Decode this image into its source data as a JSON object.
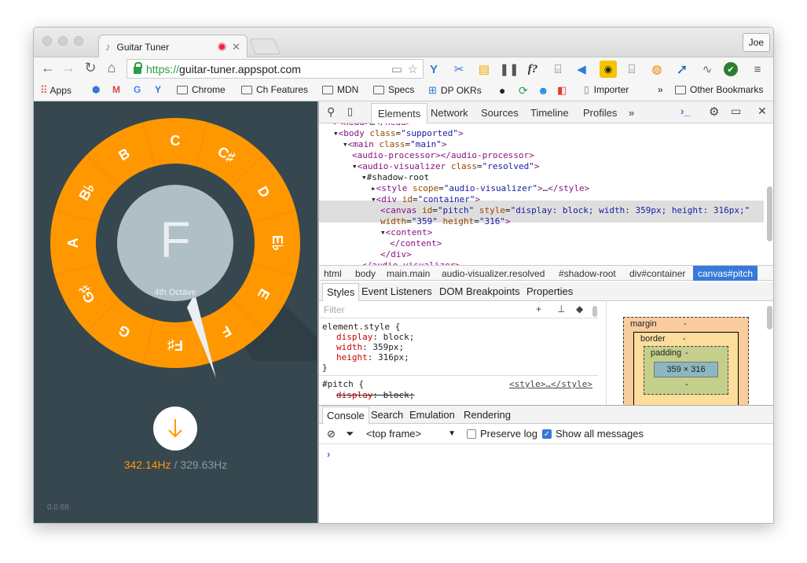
{
  "window": {
    "tab_title": "Guitar Tuner",
    "tab_favicon": "♪",
    "user_button": "Joe"
  },
  "toolbar": {
    "url_scheme": "https://",
    "url_host": "guitar-tuner.appspot.com"
  },
  "bookmarks": {
    "apps": "Apps",
    "items": [
      "Chrome",
      "Ch Features",
      "MDN",
      "Specs",
      "DP OKRs",
      "Importer"
    ],
    "overflow": "»",
    "other": "Other Bookmarks"
  },
  "tuner": {
    "notes": [
      "C",
      "C♯",
      "D",
      "E♭",
      "E",
      "F",
      "F♯",
      "G",
      "G♯",
      "A",
      "B♭",
      "B"
    ],
    "current_note": "F",
    "octave_label": "4th Octave",
    "detected_hz": "342.14Hz",
    "separator": "/",
    "target_hz": "329.63Hz",
    "version": "0.0.68",
    "colors": {
      "ring": "#ff9800",
      "background": "#37474f",
      "center": "#b0bec5",
      "accent": "#ff9800"
    }
  },
  "devtools": {
    "tabs": [
      "Elements",
      "Network",
      "Sources",
      "Timeline",
      "Profiles"
    ],
    "more": "»",
    "dom_lines": [
      {
        "indent": 0,
        "html": "▸<head>…</head>"
      },
      {
        "indent": 0,
        "html": "▾<body class=\"supported\">"
      },
      {
        "indent": 1,
        "html": "▾<main class=\"main\">"
      },
      {
        "indent": 2,
        "html": "<audio-processor></audio-processor>"
      },
      {
        "indent": 2,
        "html": "▾<audio-visualizer class=\"resolved\">"
      },
      {
        "indent": 3,
        "html": "▾#shadow-root"
      },
      {
        "indent": 4,
        "html": "▸<style scope=\"audio-visualizer\">…</style>"
      },
      {
        "indent": 4,
        "html": "▾<div id=\"container\">"
      },
      {
        "indent": 5,
        "html": "<canvas id=\"pitch\" style=\"display: block; width: 359px; height: 316px;\""
      },
      {
        "indent": 5,
        "html": "width=\"359\" height=\"316\">"
      },
      {
        "indent": 5,
        "html": "▾<content>"
      },
      {
        "indent": 6,
        "html": "</content>"
      },
      {
        "indent": 5,
        "html": "</div>"
      },
      {
        "indent": 3,
        "html": "</audio-visualizer>"
      }
    ],
    "breadcrumbs": [
      "html",
      "body",
      "main.main",
      "audio-visualizer.resolved",
      "#shadow-root",
      "div#container",
      "canvas#pitch"
    ],
    "sidebar_tabs": [
      "Styles",
      "Event Listeners",
      "DOM Breakpoints",
      "Properties"
    ],
    "filter_placeholder": "Filter",
    "element_style": {
      "selector": "element.style {",
      "props": [
        {
          "name": "display",
          "value": "block;"
        },
        {
          "name": "width",
          "value": "359px;"
        },
        {
          "name": "height",
          "value": "316px;"
        }
      ],
      "close": "}"
    },
    "rule2": {
      "selector": "#pitch {",
      "source": "<style>…</style>",
      "prop_name": "display",
      "prop_value": "block;"
    },
    "box_model": {
      "margin": "margin",
      "border": "border",
      "padding": "padding",
      "content": "359 × 316",
      "dash": "-"
    },
    "drawer_tabs": [
      "Console",
      "Search",
      "Emulation",
      "Rendering"
    ],
    "console": {
      "frame": "<top frame>",
      "preserve_log": "Preserve log",
      "show_all": "Show all messages",
      "prompt": "›"
    }
  }
}
